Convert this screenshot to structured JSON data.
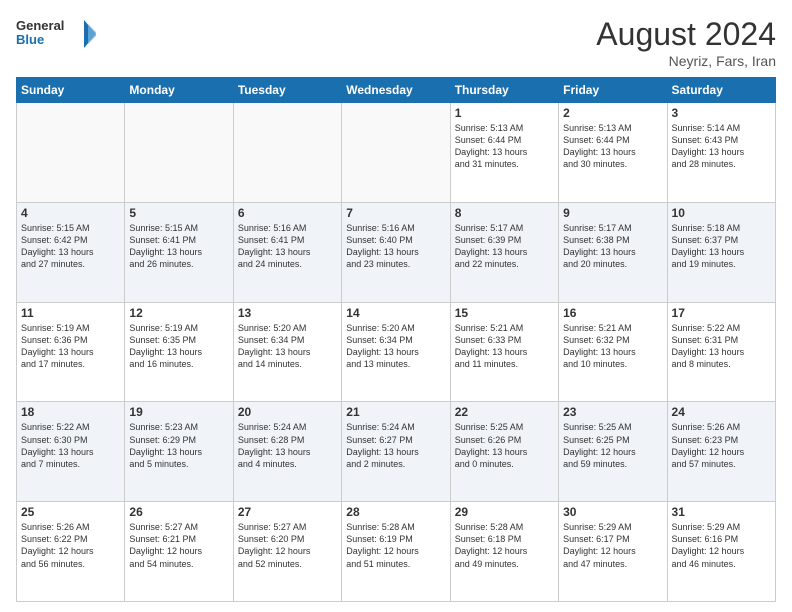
{
  "logo": {
    "line1": "General",
    "line2": "Blue"
  },
  "title": "August 2024",
  "location": "Neyriz, Fars, Iran",
  "weekdays": [
    "Sunday",
    "Monday",
    "Tuesday",
    "Wednesday",
    "Thursday",
    "Friday",
    "Saturday"
  ],
  "rows": [
    [
      {
        "day": "",
        "info": ""
      },
      {
        "day": "",
        "info": ""
      },
      {
        "day": "",
        "info": ""
      },
      {
        "day": "",
        "info": ""
      },
      {
        "day": "1",
        "info": "Sunrise: 5:13 AM\nSunset: 6:44 PM\nDaylight: 13 hours\nand 31 minutes."
      },
      {
        "day": "2",
        "info": "Sunrise: 5:13 AM\nSunset: 6:44 PM\nDaylight: 13 hours\nand 30 minutes."
      },
      {
        "day": "3",
        "info": "Sunrise: 5:14 AM\nSunset: 6:43 PM\nDaylight: 13 hours\nand 28 minutes."
      }
    ],
    [
      {
        "day": "4",
        "info": "Sunrise: 5:15 AM\nSunset: 6:42 PM\nDaylight: 13 hours\nand 27 minutes."
      },
      {
        "day": "5",
        "info": "Sunrise: 5:15 AM\nSunset: 6:41 PM\nDaylight: 13 hours\nand 26 minutes."
      },
      {
        "day": "6",
        "info": "Sunrise: 5:16 AM\nSunset: 6:41 PM\nDaylight: 13 hours\nand 24 minutes."
      },
      {
        "day": "7",
        "info": "Sunrise: 5:16 AM\nSunset: 6:40 PM\nDaylight: 13 hours\nand 23 minutes."
      },
      {
        "day": "8",
        "info": "Sunrise: 5:17 AM\nSunset: 6:39 PM\nDaylight: 13 hours\nand 22 minutes."
      },
      {
        "day": "9",
        "info": "Sunrise: 5:17 AM\nSunset: 6:38 PM\nDaylight: 13 hours\nand 20 minutes."
      },
      {
        "day": "10",
        "info": "Sunrise: 5:18 AM\nSunset: 6:37 PM\nDaylight: 13 hours\nand 19 minutes."
      }
    ],
    [
      {
        "day": "11",
        "info": "Sunrise: 5:19 AM\nSunset: 6:36 PM\nDaylight: 13 hours\nand 17 minutes."
      },
      {
        "day": "12",
        "info": "Sunrise: 5:19 AM\nSunset: 6:35 PM\nDaylight: 13 hours\nand 16 minutes."
      },
      {
        "day": "13",
        "info": "Sunrise: 5:20 AM\nSunset: 6:34 PM\nDaylight: 13 hours\nand 14 minutes."
      },
      {
        "day": "14",
        "info": "Sunrise: 5:20 AM\nSunset: 6:34 PM\nDaylight: 13 hours\nand 13 minutes."
      },
      {
        "day": "15",
        "info": "Sunrise: 5:21 AM\nSunset: 6:33 PM\nDaylight: 13 hours\nand 11 minutes."
      },
      {
        "day": "16",
        "info": "Sunrise: 5:21 AM\nSunset: 6:32 PM\nDaylight: 13 hours\nand 10 minutes."
      },
      {
        "day": "17",
        "info": "Sunrise: 5:22 AM\nSunset: 6:31 PM\nDaylight: 13 hours\nand 8 minutes."
      }
    ],
    [
      {
        "day": "18",
        "info": "Sunrise: 5:22 AM\nSunset: 6:30 PM\nDaylight: 13 hours\nand 7 minutes."
      },
      {
        "day": "19",
        "info": "Sunrise: 5:23 AM\nSunset: 6:29 PM\nDaylight: 13 hours\nand 5 minutes."
      },
      {
        "day": "20",
        "info": "Sunrise: 5:24 AM\nSunset: 6:28 PM\nDaylight: 13 hours\nand 4 minutes."
      },
      {
        "day": "21",
        "info": "Sunrise: 5:24 AM\nSunset: 6:27 PM\nDaylight: 13 hours\nand 2 minutes."
      },
      {
        "day": "22",
        "info": "Sunrise: 5:25 AM\nSunset: 6:26 PM\nDaylight: 13 hours\nand 0 minutes."
      },
      {
        "day": "23",
        "info": "Sunrise: 5:25 AM\nSunset: 6:25 PM\nDaylight: 12 hours\nand 59 minutes."
      },
      {
        "day": "24",
        "info": "Sunrise: 5:26 AM\nSunset: 6:23 PM\nDaylight: 12 hours\nand 57 minutes."
      }
    ],
    [
      {
        "day": "25",
        "info": "Sunrise: 5:26 AM\nSunset: 6:22 PM\nDaylight: 12 hours\nand 56 minutes."
      },
      {
        "day": "26",
        "info": "Sunrise: 5:27 AM\nSunset: 6:21 PM\nDaylight: 12 hours\nand 54 minutes."
      },
      {
        "day": "27",
        "info": "Sunrise: 5:27 AM\nSunset: 6:20 PM\nDaylight: 12 hours\nand 52 minutes."
      },
      {
        "day": "28",
        "info": "Sunrise: 5:28 AM\nSunset: 6:19 PM\nDaylight: 12 hours\nand 51 minutes."
      },
      {
        "day": "29",
        "info": "Sunrise: 5:28 AM\nSunset: 6:18 PM\nDaylight: 12 hours\nand 49 minutes."
      },
      {
        "day": "30",
        "info": "Sunrise: 5:29 AM\nSunset: 6:17 PM\nDaylight: 12 hours\nand 47 minutes."
      },
      {
        "day": "31",
        "info": "Sunrise: 5:29 AM\nSunset: 6:16 PM\nDaylight: 12 hours\nand 46 minutes."
      }
    ]
  ]
}
